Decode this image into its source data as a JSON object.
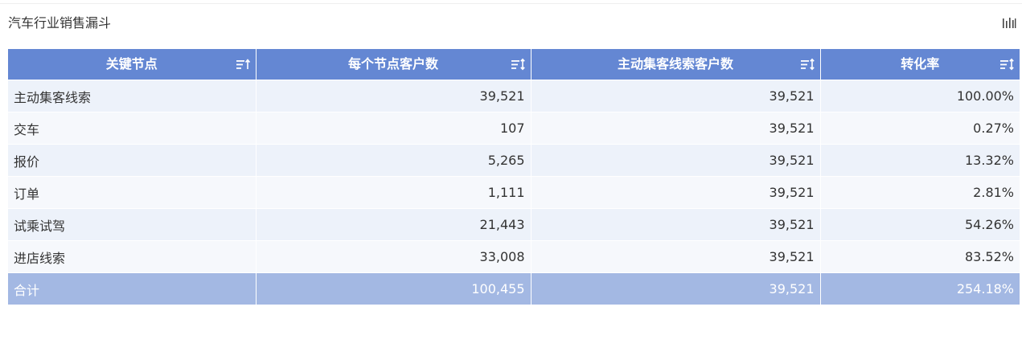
{
  "title": "汽车行业销售漏斗",
  "header": {
    "toolbar_icon": "column-chart-icon"
  },
  "colors": {
    "header_bg": "#6487d3",
    "row_odd_bg": "#edf2fa",
    "row_even_bg": "#f6f8fc",
    "total_bg": "#a3b8e3"
  },
  "table": {
    "columns": [
      "关键节点",
      "每个节点客户数",
      "主动集客线索客户数",
      "转化率"
    ],
    "rows": [
      [
        "主动集客线索",
        "39,521",
        "39,521",
        "100.00%"
      ],
      [
        "交车",
        "107",
        "39,521",
        "0.27%"
      ],
      [
        "报价",
        "5,265",
        "39,521",
        "13.32%"
      ],
      [
        "订单",
        "1,111",
        "39,521",
        "2.81%"
      ],
      [
        "试乘试驾",
        "21,443",
        "39,521",
        "54.26%"
      ],
      [
        "进店线索",
        "33,008",
        "39,521",
        "83.52%"
      ]
    ],
    "total": [
      "合计",
      "100,455",
      "39,521",
      "254.18%"
    ]
  }
}
